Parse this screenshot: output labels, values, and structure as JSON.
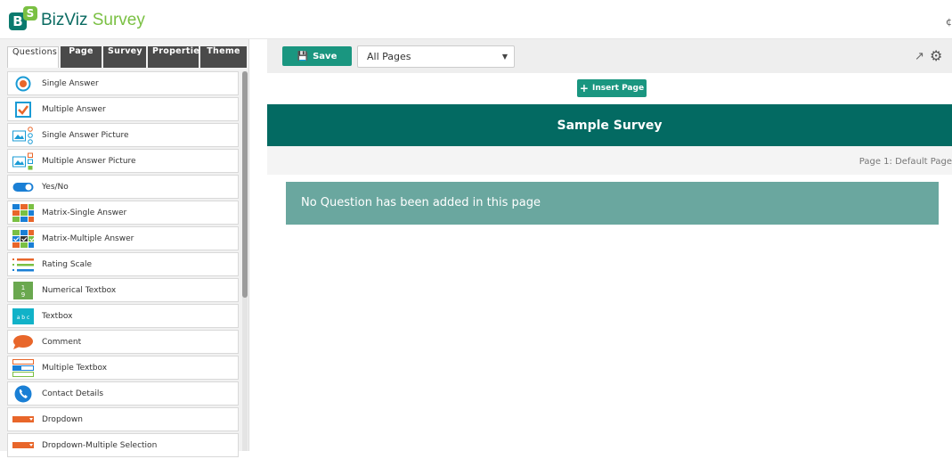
{
  "app": {
    "brand_part1": "BizViz",
    "brand_part2": "Survey",
    "logo_letter_b": "B",
    "logo_letter_s": "S",
    "edge_glyph": "¢"
  },
  "tabs": [
    {
      "label": "Questions",
      "active": true
    },
    {
      "label": "Page",
      "active": false
    },
    {
      "label": "Survey",
      "active": false
    },
    {
      "label": "Properties",
      "active": false
    },
    {
      "label": "Theme",
      "active": false
    }
  ],
  "question_types": [
    {
      "label": "Single Answer",
      "icon": "radio-icon"
    },
    {
      "label": "Multiple Answer",
      "icon": "checkbox-icon"
    },
    {
      "label": "Single Answer Picture",
      "icon": "picture-radio-icon"
    },
    {
      "label": "Multiple Answer Picture",
      "icon": "picture-checkbox-icon"
    },
    {
      "label": "Yes/No",
      "icon": "toggle-icon"
    },
    {
      "label": "Matrix-Single Answer",
      "icon": "matrix-grid-icon"
    },
    {
      "label": "Matrix-Multiple Answer",
      "icon": "matrix-check-icon"
    },
    {
      "label": "Rating Scale",
      "icon": "rating-scale-icon"
    },
    {
      "label": "Numerical Textbox",
      "icon": "numeric-icon"
    },
    {
      "label": "Textbox",
      "icon": "textbox-icon"
    },
    {
      "label": "Comment",
      "icon": "comment-icon"
    },
    {
      "label": "Multiple Textbox",
      "icon": "multi-textbox-icon"
    },
    {
      "label": "Contact Details",
      "icon": "phone-icon"
    },
    {
      "label": "Dropdown",
      "icon": "dropdown-icon"
    },
    {
      "label": "Dropdown-Multiple Selection",
      "icon": "dropdown-multi-icon"
    }
  ],
  "toolbar": {
    "save_label": "Save",
    "page_select_value": "All Pages"
  },
  "insert_page_label": "Insert Page",
  "survey_title": "Sample Survey",
  "page_label": "Page 1:  Default Page",
  "empty_message": "No Question has been added in this page",
  "colors": {
    "primary": "#036a62",
    "button": "#1a9680",
    "message_bg": "#6aa79f",
    "accent_green": "#7ac043",
    "accent_orange": "#e8662a"
  }
}
